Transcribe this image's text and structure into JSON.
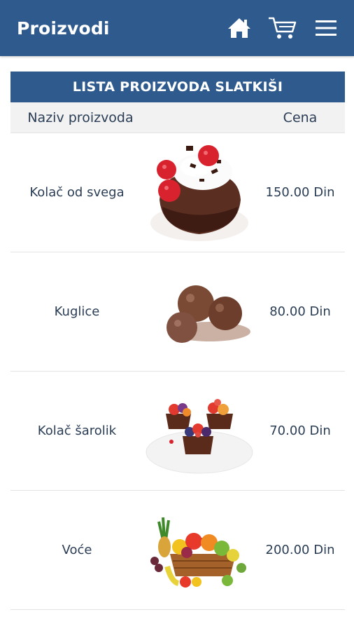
{
  "appbar": {
    "title": "Proizvodi",
    "icons": [
      "home-icon",
      "cart-icon",
      "menu-icon"
    ]
  },
  "list": {
    "header": "LISTA PROIZVODA SLATKIŠI",
    "columns": {
      "name": "Naziv proizvoda",
      "price": "Cena"
    },
    "items": [
      {
        "name": "Kolač od svega",
        "price": "150.00 Din",
        "image": "chocolate-cake-with-raspberries"
      },
      {
        "name": "Kuglice",
        "price": "80.00 Din",
        "image": "chocolate-balls"
      },
      {
        "name": "Kolač šarolik",
        "price": "70.00 Din",
        "image": "fruit-tartlets"
      },
      {
        "name": "Voće",
        "price": "200.00 Din",
        "image": "fruit-basket"
      }
    ]
  },
  "colors": {
    "primary": "#2f5a8e",
    "header_bg": "#f2f2f2",
    "text": "#2a3d55"
  }
}
